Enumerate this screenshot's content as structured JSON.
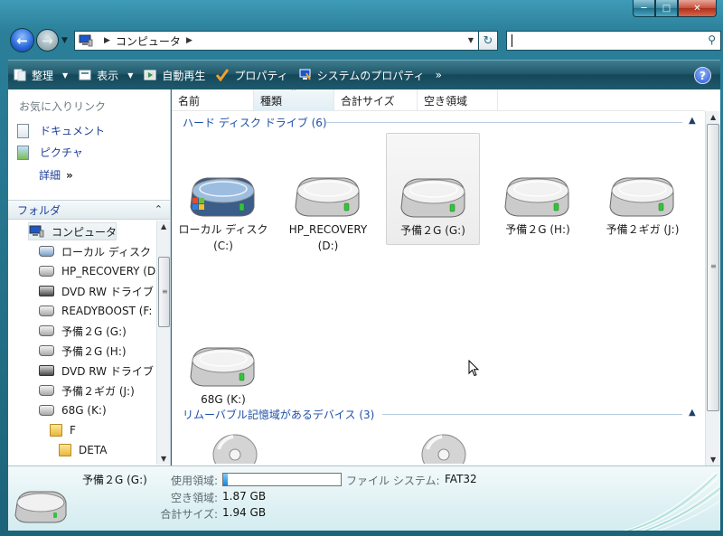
{
  "address": {
    "segments": [
      "コンピュータ"
    ]
  },
  "toolbar": {
    "organize": "整理",
    "view": "表示",
    "autoplay": "自動再生",
    "properties": "プロパティ",
    "system_properties": "システムのプロパティ",
    "more": "»",
    "help": "?"
  },
  "nav": {
    "favorites_header": "お気に入りリンク",
    "favorites": [
      {
        "label": "ドキュメント"
      },
      {
        "label": "ピクチャ"
      }
    ],
    "more_label": "詳細",
    "more_chevron": "»",
    "folders_label": "フォルダ",
    "tree": [
      {
        "label": "コンピュータ",
        "icon": "computer"
      },
      {
        "label": "ローカル ディスク",
        "icon": "windows-drive"
      },
      {
        "label": "HP_RECOVERY (D",
        "icon": "drive"
      },
      {
        "label": "DVD RW ドライブ",
        "icon": "dvd"
      },
      {
        "label": "READYBOOST (F:",
        "icon": "drive"
      },
      {
        "label": "予備２G (G:)",
        "icon": "drive"
      },
      {
        "label": "予備２G (H:)",
        "icon": "drive"
      },
      {
        "label": "DVD RW ドライブ",
        "icon": "dvd"
      },
      {
        "label": "予備２ギガ (J:)",
        "icon": "drive"
      },
      {
        "label": "68G (K:)",
        "icon": "drive"
      },
      {
        "label": "F",
        "icon": "folder"
      },
      {
        "label": "DETA",
        "icon": "folder"
      }
    ]
  },
  "columns": [
    "名前",
    "種類",
    "合計サイズ",
    "空き領域"
  ],
  "groups": {
    "hdd_header": "ハード ディスク ドライブ (6)",
    "removable_header": "リムーバブル記憶域があるデバイス (3)"
  },
  "drives": [
    {
      "line1": "ローカル ディスク",
      "line2": "(C:)",
      "windows": true
    },
    {
      "line1": "HP_RECOVERY",
      "line2": "(D:)",
      "windows": false
    },
    {
      "line1": "予備２G (G:)",
      "line2": "",
      "windows": false
    },
    {
      "line1": "予備２G (H:)",
      "line2": "",
      "windows": false
    },
    {
      "line1": "予備２ギガ (J:)",
      "line2": "",
      "windows": false
    },
    {
      "line1": "68G (K:)",
      "line2": "",
      "windows": false
    }
  ],
  "details": {
    "name": "予備２G (G:)",
    "used_label": "使用領域:",
    "free_label": "空き領域:",
    "free_value": "1.87 GB",
    "total_label": "合計サイズ:",
    "total_value": "1.94 GB",
    "fs_label": "ファイル システム:",
    "fs_value": "FAT32",
    "used_fraction": 0.036
  }
}
